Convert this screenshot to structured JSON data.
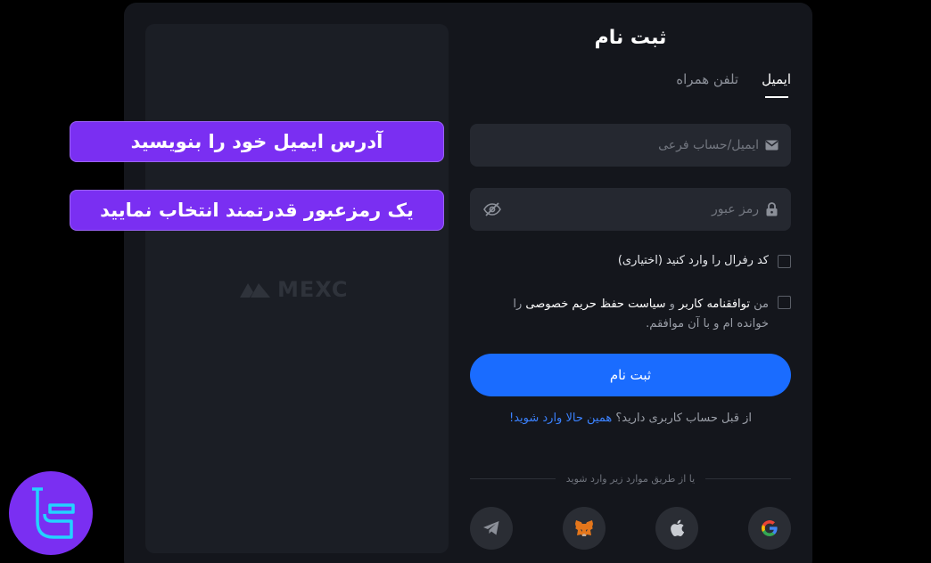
{
  "form": {
    "title": "ثبت نام",
    "tabs": [
      {
        "label": "ایمیل",
        "active": true
      },
      {
        "label": "تلفن همراه",
        "active": false
      }
    ],
    "email_placeholder": "ایمیل/حساب فرعی",
    "password_placeholder": "رمز عبور",
    "referral_label": "کد رفرال را وارد کنید (اختیاری)",
    "terms": {
      "prefix": "من",
      "user_agreement": "توافقنامه کاربر",
      "and": "و",
      "privacy_policy": "سیاست حفظ حریم خصوصی",
      "suffix": "را خوانده ام و با آن موافقم."
    },
    "submit_label": "ثبت نام",
    "login_prompt": "از قبل حساب کاربری دارید؟",
    "login_link": "همین حالا وارد شوید!",
    "divider_text": "یا از طریق موارد زیر وارد شوید"
  },
  "social_icons": [
    "google-icon",
    "apple-icon",
    "metamask-icon",
    "telegram-icon"
  ],
  "left_panel": {
    "logo_text": "MEXC"
  },
  "callouts": [
    "آدرس ایمیل خود را بنویسید",
    "یک رمزعبور قدرتمند انتخاب نمایید"
  ],
  "colors": {
    "accent": "#1a6cff",
    "callout": "#7a2ff2",
    "link": "#3b82ff",
    "panel": "#14161c"
  }
}
